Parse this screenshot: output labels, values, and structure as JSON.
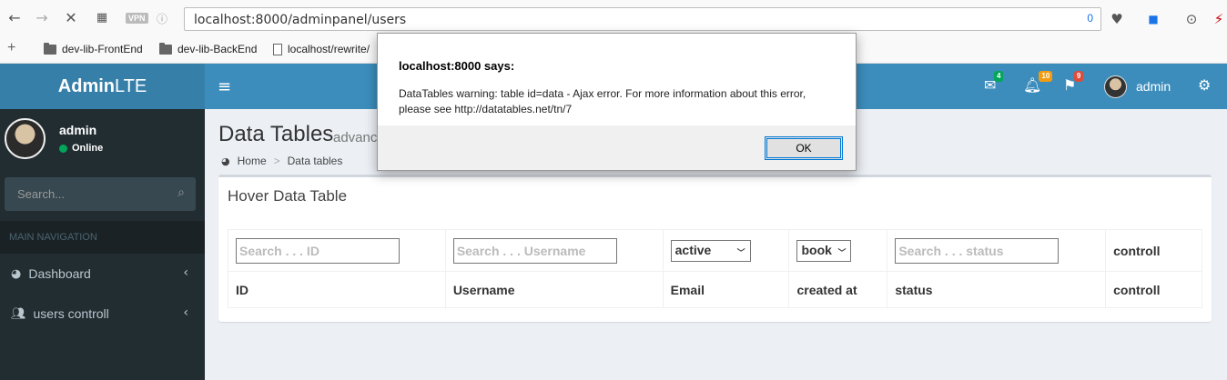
{
  "browser": {
    "vpn_label": "VPN",
    "url": "localhost:8000/adminpanel/users",
    "url_badge": "0",
    "bookmarks": [
      {
        "label": "dev-lib-FrontEnd"
      },
      {
        "label": "dev-lib-BackEnd"
      },
      {
        "label": "localhost/rewrite/"
      }
    ]
  },
  "header": {
    "logo_bold": "Admin",
    "logo_rest": "LTE",
    "mail_count": "4",
    "notif_count": "10",
    "flag_count": "9",
    "user": "admin"
  },
  "sidebar": {
    "user_name": "admin",
    "status": "Online",
    "search_placeholder": "Search...",
    "nav_header": "MAIN NAVIGATION",
    "items": [
      {
        "label": "Dashboard",
        "icon": "dashboard-icon"
      },
      {
        "label": "users controll",
        "icon": "users-icon"
      }
    ]
  },
  "content": {
    "title": "Data Tables",
    "subtitle": "advance",
    "breadcrumb": {
      "home": "Home",
      "sep": ">",
      "current": "Data tables"
    },
    "box_title": "Hover Data Table",
    "filters": {
      "id_placeholder": "Search . . . ID",
      "username_placeholder": "Search . . . Username",
      "email_select": "active",
      "created_select": "book",
      "status_placeholder": "Search . . . status",
      "controll": "controll"
    },
    "columns": [
      "ID",
      "Username",
      "Email",
      "created at",
      "status",
      "controll"
    ]
  },
  "dialog": {
    "title": "localhost:8000 says:",
    "message": "DataTables warning: table id=data - Ajax error. For more information about this error, please see http://datatables.net/tn/7",
    "ok_label": "OK"
  },
  "colors": {
    "header_blue": "#3c8dbc",
    "logo_blue": "#367fa9",
    "sidebar_dark": "#222d32",
    "badge_green": "#00a65a",
    "badge_orange": "#f39c12",
    "badge_red": "#dd4b39"
  }
}
